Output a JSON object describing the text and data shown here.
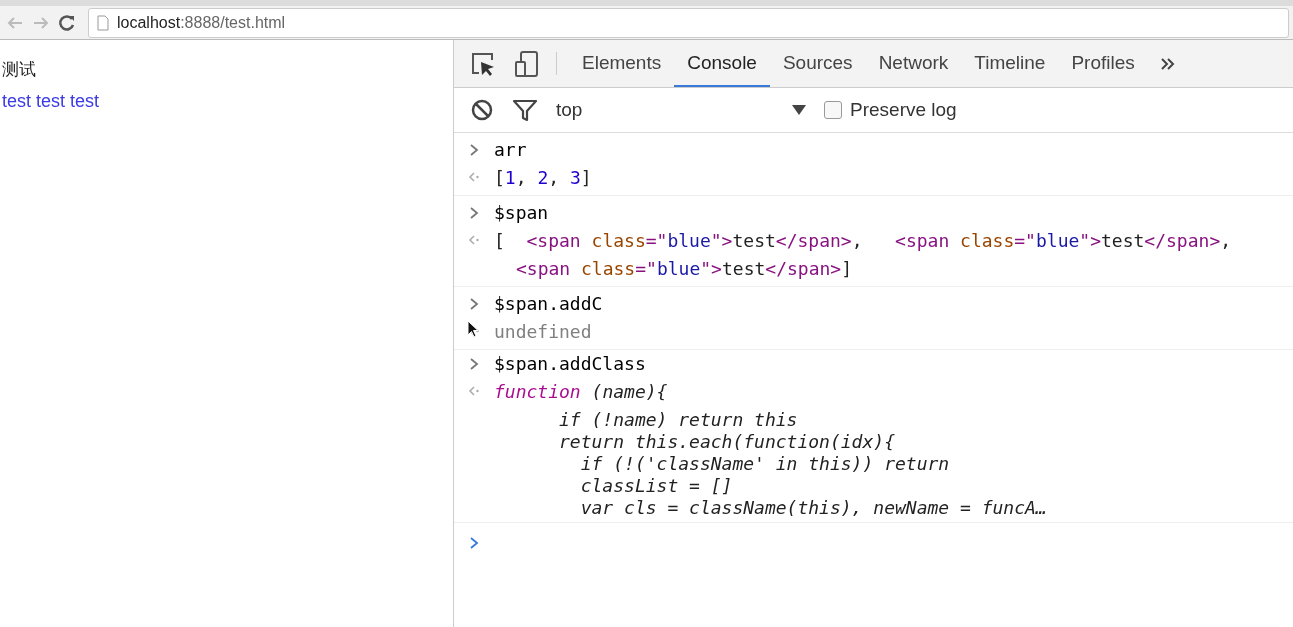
{
  "browser": {
    "url_host": "localhost",
    "url_rest": ":8888/test.html"
  },
  "page": {
    "heading": "测试",
    "link_text": "test test test"
  },
  "devtools": {
    "tabs": [
      {
        "label": "Elements",
        "selected": false
      },
      {
        "label": "Console",
        "selected": true
      },
      {
        "label": "Sources",
        "selected": false
      },
      {
        "label": "Network",
        "selected": false
      },
      {
        "label": "Timeline",
        "selected": false
      },
      {
        "label": "Profiles",
        "selected": false
      }
    ],
    "context": "top",
    "preserve_log": {
      "label": "Preserve log",
      "checked": false
    },
    "entries": [
      {
        "input": "arr",
        "italic": false,
        "output": [
          [
            {
              "kind": "text",
              "text": "["
            },
            {
              "kind": "number",
              "text": "1"
            },
            {
              "kind": "text",
              "text": ", "
            },
            {
              "kind": "number",
              "text": "2"
            },
            {
              "kind": "text",
              "text": ", "
            },
            {
              "kind": "number",
              "text": "3"
            },
            {
              "kind": "text",
              "text": "]"
            }
          ]
        ]
      },
      {
        "input": "$span",
        "italic": false,
        "output": [
          [
            {
              "kind": "text",
              "text": "[  "
            },
            {
              "kind": "tag",
              "text": "<span"
            },
            {
              "kind": "attr",
              "text": " class"
            },
            {
              "kind": "tag",
              "text": "=\""
            },
            {
              "kind": "value",
              "text": "blue"
            },
            {
              "kind": "tag",
              "text": "\">"
            },
            {
              "kind": "text",
              "text": "test"
            },
            {
              "kind": "tag",
              "text": "</span>"
            },
            {
              "kind": "text",
              "text": ",   "
            },
            {
              "kind": "tag",
              "text": "<span"
            },
            {
              "kind": "attr",
              "text": " class"
            },
            {
              "kind": "tag",
              "text": "=\""
            },
            {
              "kind": "value",
              "text": "blue"
            },
            {
              "kind": "tag",
              "text": "\">"
            },
            {
              "kind": "text",
              "text": "test"
            },
            {
              "kind": "tag",
              "text": "</span>"
            },
            {
              "kind": "text",
              "text": ","
            }
          ],
          [
            {
              "kind": "tag",
              "text": "<span"
            },
            {
              "kind": "attr",
              "text": " class"
            },
            {
              "kind": "tag",
              "text": "=\""
            },
            {
              "kind": "value",
              "text": "blue"
            },
            {
              "kind": "tag",
              "text": "\">"
            },
            {
              "kind": "text",
              "text": "test"
            },
            {
              "kind": "tag",
              "text": "</span>"
            },
            {
              "kind": "text",
              "text": "]"
            }
          ]
        ]
      },
      {
        "input": "$span.addC",
        "italic": false,
        "output": [
          [
            {
              "kind": "muted",
              "text": "undefined"
            }
          ]
        ]
      },
      {
        "input": "$span.addClass",
        "italic": true,
        "output": [
          [
            {
              "kind": "keyword",
              "text": "function"
            },
            {
              "kind": "text",
              "text": " (name){"
            }
          ],
          [
            {
              "kind": "text",
              "text": "      if (!name) return this"
            }
          ],
          [
            {
              "kind": "text",
              "text": "      return this.each(function(idx){"
            }
          ],
          [
            {
              "kind": "text",
              "text": "        if (!('className' in this)) return"
            }
          ],
          [
            {
              "kind": "text",
              "text": "        classList = []"
            }
          ],
          [
            {
              "kind": "text",
              "text": "        var cls = className(this), newName = funcA…"
            }
          ]
        ]
      }
    ]
  }
}
